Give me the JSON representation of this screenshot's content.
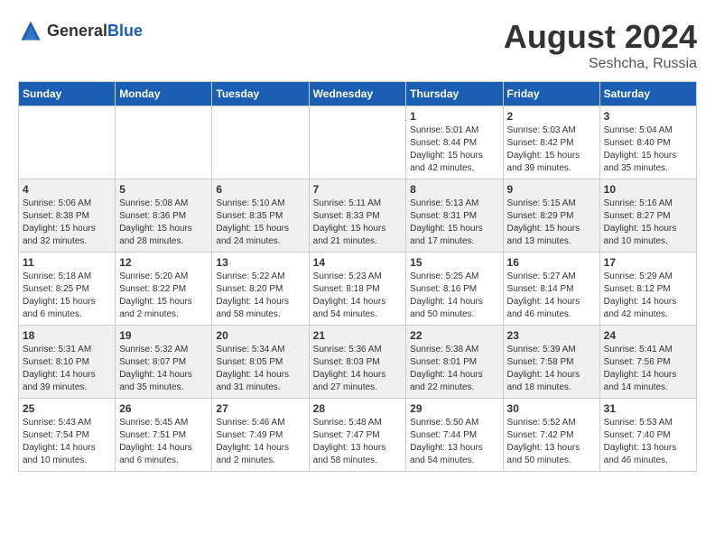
{
  "header": {
    "logo_general": "General",
    "logo_blue": "Blue",
    "month_year": "August 2024",
    "location": "Seshcha, Russia"
  },
  "days_of_week": [
    "Sunday",
    "Monday",
    "Tuesday",
    "Wednesday",
    "Thursday",
    "Friday",
    "Saturday"
  ],
  "weeks": [
    {
      "days": [
        {
          "num": "",
          "info": ""
        },
        {
          "num": "",
          "info": ""
        },
        {
          "num": "",
          "info": ""
        },
        {
          "num": "",
          "info": ""
        },
        {
          "num": "1",
          "info": "Sunrise: 5:01 AM\nSunset: 8:44 PM\nDaylight: 15 hours\nand 42 minutes."
        },
        {
          "num": "2",
          "info": "Sunrise: 5:03 AM\nSunset: 8:42 PM\nDaylight: 15 hours\nand 39 minutes."
        },
        {
          "num": "3",
          "info": "Sunrise: 5:04 AM\nSunset: 8:40 PM\nDaylight: 15 hours\nand 35 minutes."
        }
      ]
    },
    {
      "days": [
        {
          "num": "4",
          "info": "Sunrise: 5:06 AM\nSunset: 8:38 PM\nDaylight: 15 hours\nand 32 minutes."
        },
        {
          "num": "5",
          "info": "Sunrise: 5:08 AM\nSunset: 8:36 PM\nDaylight: 15 hours\nand 28 minutes."
        },
        {
          "num": "6",
          "info": "Sunrise: 5:10 AM\nSunset: 8:35 PM\nDaylight: 15 hours\nand 24 minutes."
        },
        {
          "num": "7",
          "info": "Sunrise: 5:11 AM\nSunset: 8:33 PM\nDaylight: 15 hours\nand 21 minutes."
        },
        {
          "num": "8",
          "info": "Sunrise: 5:13 AM\nSunset: 8:31 PM\nDaylight: 15 hours\nand 17 minutes."
        },
        {
          "num": "9",
          "info": "Sunrise: 5:15 AM\nSunset: 8:29 PM\nDaylight: 15 hours\nand 13 minutes."
        },
        {
          "num": "10",
          "info": "Sunrise: 5:16 AM\nSunset: 8:27 PM\nDaylight: 15 hours\nand 10 minutes."
        }
      ]
    },
    {
      "days": [
        {
          "num": "11",
          "info": "Sunrise: 5:18 AM\nSunset: 8:25 PM\nDaylight: 15 hours\nand 6 minutes."
        },
        {
          "num": "12",
          "info": "Sunrise: 5:20 AM\nSunset: 8:22 PM\nDaylight: 15 hours\nand 2 minutes."
        },
        {
          "num": "13",
          "info": "Sunrise: 5:22 AM\nSunset: 8:20 PM\nDaylight: 14 hours\nand 58 minutes."
        },
        {
          "num": "14",
          "info": "Sunrise: 5:23 AM\nSunset: 8:18 PM\nDaylight: 14 hours\nand 54 minutes."
        },
        {
          "num": "15",
          "info": "Sunrise: 5:25 AM\nSunset: 8:16 PM\nDaylight: 14 hours\nand 50 minutes."
        },
        {
          "num": "16",
          "info": "Sunrise: 5:27 AM\nSunset: 8:14 PM\nDaylight: 14 hours\nand 46 minutes."
        },
        {
          "num": "17",
          "info": "Sunrise: 5:29 AM\nSunset: 8:12 PM\nDaylight: 14 hours\nand 42 minutes."
        }
      ]
    },
    {
      "days": [
        {
          "num": "18",
          "info": "Sunrise: 5:31 AM\nSunset: 8:10 PM\nDaylight: 14 hours\nand 39 minutes."
        },
        {
          "num": "19",
          "info": "Sunrise: 5:32 AM\nSunset: 8:07 PM\nDaylight: 14 hours\nand 35 minutes."
        },
        {
          "num": "20",
          "info": "Sunrise: 5:34 AM\nSunset: 8:05 PM\nDaylight: 14 hours\nand 31 minutes."
        },
        {
          "num": "21",
          "info": "Sunrise: 5:36 AM\nSunset: 8:03 PM\nDaylight: 14 hours\nand 27 minutes."
        },
        {
          "num": "22",
          "info": "Sunrise: 5:38 AM\nSunset: 8:01 PM\nDaylight: 14 hours\nand 22 minutes."
        },
        {
          "num": "23",
          "info": "Sunrise: 5:39 AM\nSunset: 7:58 PM\nDaylight: 14 hours\nand 18 minutes."
        },
        {
          "num": "24",
          "info": "Sunrise: 5:41 AM\nSunset: 7:56 PM\nDaylight: 14 hours\nand 14 minutes."
        }
      ]
    },
    {
      "days": [
        {
          "num": "25",
          "info": "Sunrise: 5:43 AM\nSunset: 7:54 PM\nDaylight: 14 hours\nand 10 minutes."
        },
        {
          "num": "26",
          "info": "Sunrise: 5:45 AM\nSunset: 7:51 PM\nDaylight: 14 hours\nand 6 minutes."
        },
        {
          "num": "27",
          "info": "Sunrise: 5:46 AM\nSunset: 7:49 PM\nDaylight: 14 hours\nand 2 minutes."
        },
        {
          "num": "28",
          "info": "Sunrise: 5:48 AM\nSunset: 7:47 PM\nDaylight: 13 hours\nand 58 minutes."
        },
        {
          "num": "29",
          "info": "Sunrise: 5:50 AM\nSunset: 7:44 PM\nDaylight: 13 hours\nand 54 minutes."
        },
        {
          "num": "30",
          "info": "Sunrise: 5:52 AM\nSunset: 7:42 PM\nDaylight: 13 hours\nand 50 minutes."
        },
        {
          "num": "31",
          "info": "Sunrise: 5:53 AM\nSunset: 7:40 PM\nDaylight: 13 hours\nand 46 minutes."
        }
      ]
    }
  ]
}
